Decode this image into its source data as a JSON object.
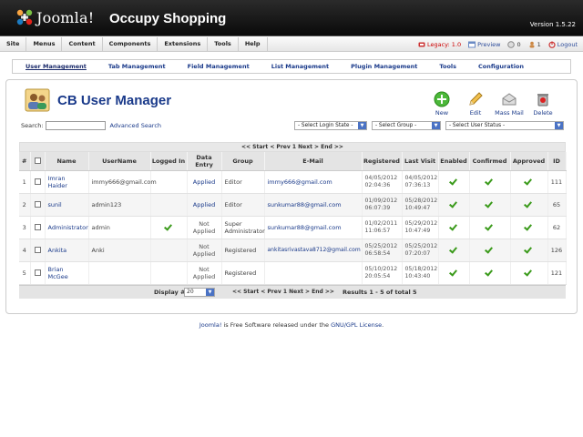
{
  "header": {
    "logo_text": "Joomla!",
    "site_name": "Occupy Shopping",
    "version": "Version 1.5.22"
  },
  "menu": [
    "Site",
    "Menus",
    "Content",
    "Components",
    "Extensions",
    "Tools",
    "Help"
  ],
  "status": {
    "legacy": "Legacy: 1.0",
    "preview": "Preview",
    "messages": "0",
    "users": "1",
    "logout": "Logout"
  },
  "subtabs": [
    "User Management",
    "Tab Management",
    "Field Management",
    "List Management",
    "Plugin Management",
    "Tools",
    "Configuration"
  ],
  "page": {
    "title": "CB User Manager"
  },
  "toolbar": {
    "new": "New",
    "edit": "Edit",
    "mass_mail": "Mass Mail",
    "delete": "Delete"
  },
  "search": {
    "label": "Search:",
    "value": "",
    "advanced": "Advanced Search"
  },
  "filters": {
    "login_state": "- Select Login State -",
    "group": "- Select Group -",
    "user_status": "- Select User Status -"
  },
  "pager": {
    "top": "<< Start < Prev 1 Next > End >>",
    "bottom": "<< Start < Prev 1 Next > End >>",
    "display_label": "Display #",
    "display_value": "20",
    "results": "Results 1 - 5 of total 5"
  },
  "table": {
    "columns": [
      "#",
      "",
      "Name",
      "UserName",
      "Logged In",
      "Data Entry",
      "Group",
      "E-Mail",
      "Registered",
      "Last Visit",
      "Enabled",
      "Confirmed",
      "Approved",
      "ID"
    ],
    "rows": [
      {
        "num": "1",
        "name": "Imran Haider",
        "username": "immy666@gmail.com",
        "logged_in": false,
        "data_entry_line1": "Applied",
        "data_entry_line2": "",
        "applied": true,
        "group_line1": "Editor",
        "group_line2": "",
        "email": "immy666@gmail.com",
        "reg_date": "04/05/2012",
        "reg_time": "02:04:36",
        "visit_date": "04/05/2012",
        "visit_time": "07:36:13",
        "enabled": true,
        "confirmed": true,
        "approved": true,
        "id": "111"
      },
      {
        "num": "2",
        "name": "sunil",
        "username": "admin123",
        "logged_in": false,
        "data_entry_line1": "Applied",
        "data_entry_line2": "",
        "applied": true,
        "group_line1": "Editor",
        "group_line2": "",
        "email": "sunkumar88@gmail.com",
        "reg_date": "01/09/2012",
        "reg_time": "06:07:39",
        "visit_date": "05/28/2012",
        "visit_time": "10:49:47",
        "enabled": true,
        "confirmed": true,
        "approved": true,
        "id": "65"
      },
      {
        "num": "3",
        "name": "Administrator",
        "username": "admin",
        "logged_in": true,
        "data_entry_line1": "Not",
        "data_entry_line2": "Applied",
        "applied": false,
        "group_line1": "Super",
        "group_line2": "Administrator",
        "email": "sunkumar88@gmail.com",
        "reg_date": "01/02/2011",
        "reg_time": "11:06:57",
        "visit_date": "05/29/2012",
        "visit_time": "10:47:49",
        "enabled": true,
        "confirmed": true,
        "approved": true,
        "id": "62"
      },
      {
        "num": "4",
        "name": "Ankita",
        "username": "Anki",
        "logged_in": false,
        "data_entry_line1": "Not",
        "data_entry_line2": "Applied",
        "applied": false,
        "group_line1": "Registered",
        "group_line2": "",
        "email": "ankitasrivastava8712@gmail.com",
        "reg_date": "05/25/2012",
        "reg_time": "06:58:54",
        "visit_date": "05/25/2012",
        "visit_time": "07:20:07",
        "enabled": true,
        "confirmed": true,
        "approved": true,
        "id": "126"
      },
      {
        "num": "5",
        "name": "Brian McGee",
        "username": "",
        "logged_in": false,
        "data_entry_line1": "Not",
        "data_entry_line2": "Applied",
        "applied": false,
        "group_line1": "Registered",
        "group_line2": "",
        "email": "",
        "reg_date": "05/10/2012",
        "reg_time": "20:05:54",
        "visit_date": "05/18/2012",
        "visit_time": "10:43:40",
        "enabled": true,
        "confirmed": true,
        "approved": true,
        "id": "121"
      }
    ]
  },
  "footer": {
    "joomla_link": "Joomla!",
    "middle": " is Free Software released under the ",
    "license_link": "GNU/GPL License",
    "end": "."
  },
  "colors": {
    "header_bg": "#1a1a1a",
    "link": "#1a3a8a",
    "check": "#3a9a1a",
    "dropdown_btn": "#4a72c4"
  }
}
